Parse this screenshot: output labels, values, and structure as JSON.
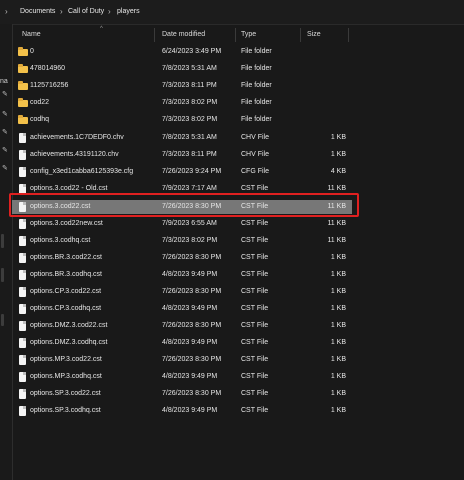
{
  "breadcrumb": {
    "items": [
      "Documents",
      "Call of Duty",
      "players"
    ],
    "separator_glyph": "›"
  },
  "sidebar": {
    "label": "na"
  },
  "columns": {
    "name": "Name",
    "date": "Date modified",
    "type": "Type",
    "size": "Size"
  },
  "files": [
    {
      "name": "0",
      "date": "6/24/2023 3:49 PM",
      "type": "File folder",
      "size": "",
      "kind": "folder"
    },
    {
      "name": "478014960",
      "date": "7/8/2023 5:31 AM",
      "type": "File folder",
      "size": "",
      "kind": "folder"
    },
    {
      "name": "1125716256",
      "date": "7/3/2023 8:11 PM",
      "type": "File folder",
      "size": "",
      "kind": "folder"
    },
    {
      "name": "cod22",
      "date": "7/3/2023 8:02 PM",
      "type": "File folder",
      "size": "",
      "kind": "folder"
    },
    {
      "name": "codhq",
      "date": "7/3/2023 8:02 PM",
      "type": "File folder",
      "size": "",
      "kind": "folder"
    },
    {
      "name": "achievements.1C7DEDF0.chv",
      "date": "7/8/2023 5:31 AM",
      "type": "CHV File",
      "size": "1 KB",
      "kind": "file"
    },
    {
      "name": "achievements.43191120.chv",
      "date": "7/3/2023 8:11 PM",
      "type": "CHV File",
      "size": "1 KB",
      "kind": "file"
    },
    {
      "name": "config_x3ed1cabba6125393e.cfg",
      "date": "7/26/2023 9:24 PM",
      "type": "CFG File",
      "size": "4 KB",
      "kind": "file"
    },
    {
      "name": "options.3.cod22 - Old.cst",
      "date": "7/9/2023 7:17 AM",
      "type": "CST File",
      "size": "11 KB",
      "kind": "file"
    },
    {
      "name": "options.3.cod22.cst",
      "date": "7/26/2023 8:30 PM",
      "type": "CST File",
      "size": "11 KB",
      "kind": "file",
      "selected": true
    },
    {
      "name": "options.3.cod22new.cst",
      "date": "7/9/2023 6:55 AM",
      "type": "CST File",
      "size": "11 KB",
      "kind": "file"
    },
    {
      "name": "options.3.codhq.cst",
      "date": "7/3/2023 8:02 PM",
      "type": "CST File",
      "size": "11 KB",
      "kind": "file"
    },
    {
      "name": "options.BR.3.cod22.cst",
      "date": "7/26/2023 8:30 PM",
      "type": "CST File",
      "size": "1 KB",
      "kind": "file"
    },
    {
      "name": "options.BR.3.codhq.cst",
      "date": "4/8/2023 9:49 PM",
      "type": "CST File",
      "size": "1 KB",
      "kind": "file"
    },
    {
      "name": "options.CP.3.cod22.cst",
      "date": "7/26/2023 8:30 PM",
      "type": "CST File",
      "size": "1 KB",
      "kind": "file"
    },
    {
      "name": "options.CP.3.codhq.cst",
      "date": "4/8/2023 9:49 PM",
      "type": "CST File",
      "size": "1 KB",
      "kind": "file"
    },
    {
      "name": "options.DMZ.3.cod22.cst",
      "date": "7/26/2023 8:30 PM",
      "type": "CST File",
      "size": "1 KB",
      "kind": "file"
    },
    {
      "name": "options.DMZ.3.codhq.cst",
      "date": "4/8/2023 9:49 PM",
      "type": "CST File",
      "size": "1 KB",
      "kind": "file"
    },
    {
      "name": "options.MP.3.cod22.cst",
      "date": "7/26/2023 8:30 PM",
      "type": "CST File",
      "size": "1 KB",
      "kind": "file"
    },
    {
      "name": "options.MP.3.codhq.cst",
      "date": "4/8/2023 9:49 PM",
      "type": "CST File",
      "size": "1 KB",
      "kind": "file"
    },
    {
      "name": "options.SP.3.cod22.cst",
      "date": "7/26/2023 8:30 PM",
      "type": "CST File",
      "size": "1 KB",
      "kind": "file"
    },
    {
      "name": "options.SP.3.codhq.cst",
      "date": "4/8/2023 9:49 PM",
      "type": "CST File",
      "size": "1 KB",
      "kind": "file"
    }
  ],
  "colors": {
    "background": "#191919",
    "selected_row": "#777777",
    "highlight_border": "#e02020",
    "folder": "#f3c14a"
  }
}
